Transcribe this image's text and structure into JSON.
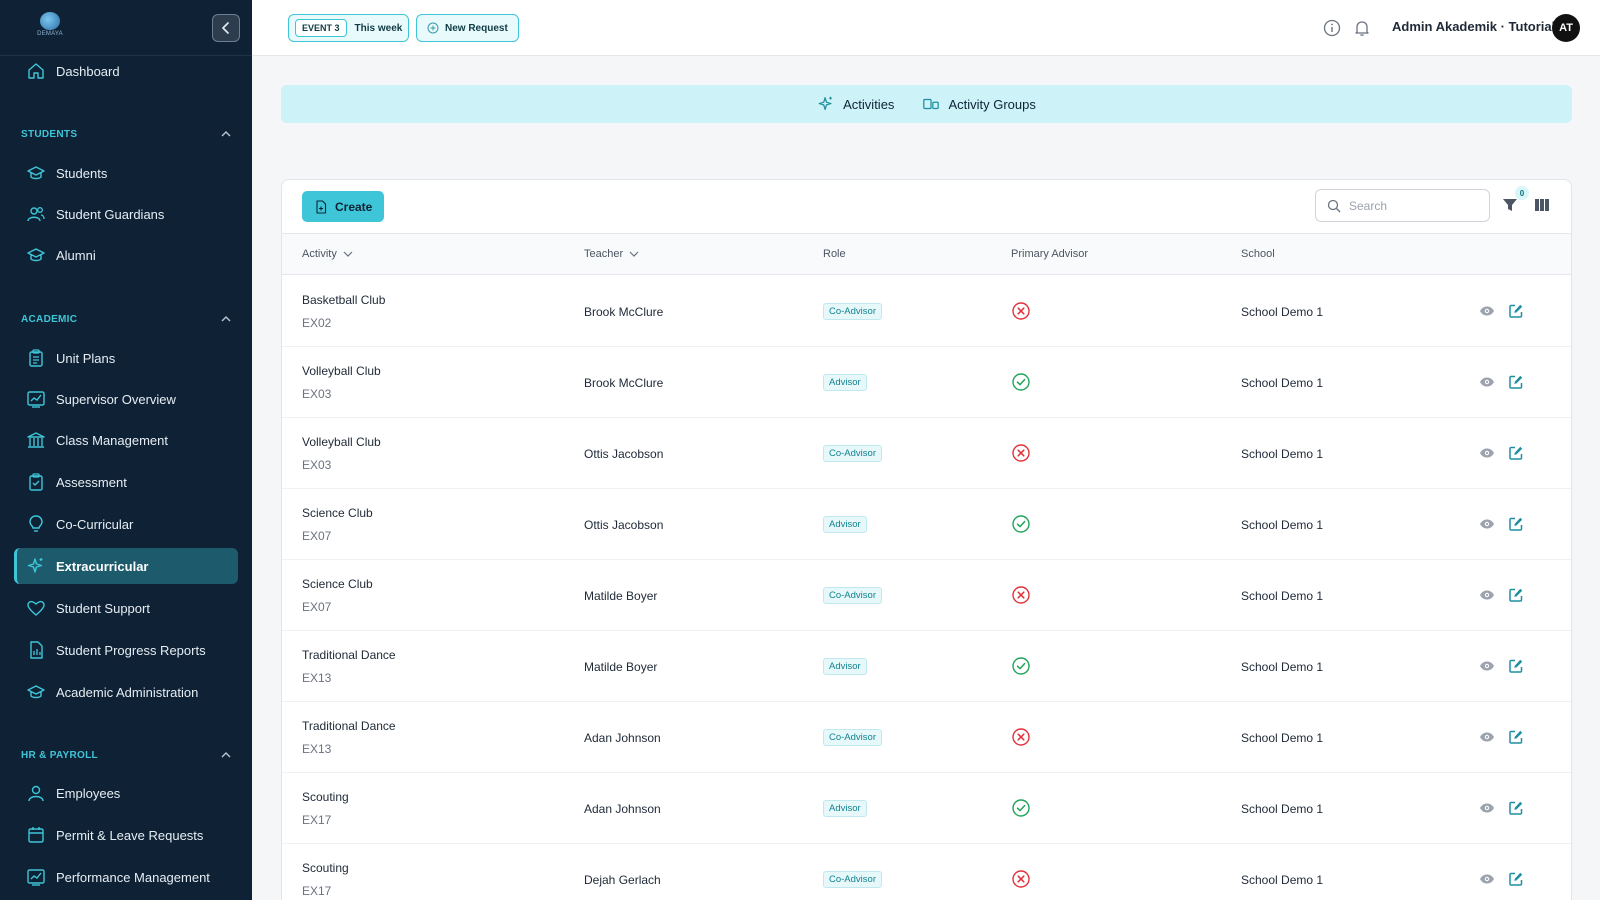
{
  "app": {
    "logo_text": "DEMAYA",
    "collapse_label": "Collapse sidebar"
  },
  "sidebar": {
    "dashboard": "Dashboard",
    "sections": [
      {
        "title": "STUDENTS",
        "items": [
          "Students",
          "Student Guardians",
          "Alumni"
        ]
      },
      {
        "title": "ACADEMIC",
        "items": [
          "Unit Plans",
          "Supervisor Overview",
          "Class Management",
          "Assessment",
          "Co-Curricular",
          "Extracurricular",
          "Student Support",
          "Student Progress Reports",
          "Academic Administration"
        ]
      },
      {
        "title": "HR & PAYROLL",
        "items": [
          "Employees",
          "Permit & Leave Requests",
          "Performance Management"
        ]
      }
    ],
    "active_item": "Extracurricular"
  },
  "topbar": {
    "event_tag": "EVENT 3",
    "event_period": "This week",
    "new_request": "New Request",
    "user_name": "Admin Akademik · Tutorial",
    "avatar_initials": "AT"
  },
  "tabs": [
    {
      "label": "Activities",
      "icon": "sparkle-icon"
    },
    {
      "label": "Activity Groups",
      "icon": "groups-icon"
    }
  ],
  "toolbar": {
    "create_label": "Create",
    "search_placeholder": "Search",
    "filter_count": "0"
  },
  "table": {
    "columns": [
      "Activity",
      "Teacher",
      "Role",
      "Primary Advisor",
      "School"
    ],
    "rows": [
      {
        "activity": "Basketball Club",
        "code": "EX02",
        "teacher": "Brook McClure",
        "role": "Co-Advisor",
        "primary": false,
        "school": "School Demo 1"
      },
      {
        "activity": "Volleyball Club",
        "code": "EX03",
        "teacher": "Brook McClure",
        "role": "Advisor",
        "primary": true,
        "school": "School Demo 1"
      },
      {
        "activity": "Volleyball Club",
        "code": "EX03",
        "teacher": "Ottis Jacobson",
        "role": "Co-Advisor",
        "primary": false,
        "school": "School Demo 1"
      },
      {
        "activity": "Science Club",
        "code": "EX07",
        "teacher": "Ottis Jacobson",
        "role": "Advisor",
        "primary": true,
        "school": "School Demo 1"
      },
      {
        "activity": "Science Club",
        "code": "EX07",
        "teacher": "Matilde Boyer",
        "role": "Co-Advisor",
        "primary": false,
        "school": "School Demo 1"
      },
      {
        "activity": "Traditional Dance",
        "code": "EX13",
        "teacher": "Matilde Boyer",
        "role": "Advisor",
        "primary": true,
        "school": "School Demo 1"
      },
      {
        "activity": "Traditional Dance",
        "code": "EX13",
        "teacher": "Adan Johnson",
        "role": "Co-Advisor",
        "primary": false,
        "school": "School Demo 1"
      },
      {
        "activity": "Scouting",
        "code": "EX17",
        "teacher": "Adan Johnson",
        "role": "Advisor",
        "primary": true,
        "school": "School Demo 1"
      },
      {
        "activity": "Scouting",
        "code": "EX17",
        "teacher": "Dejah Gerlach",
        "role": "Co-Advisor",
        "primary": false,
        "school": "School Demo 1"
      }
    ]
  },
  "colors": {
    "sidebar_bg": "#0f2235",
    "accent": "#3ec6d8",
    "active_bg": "#1d5a6b",
    "success": "#22a35a",
    "danger": "#e0323b"
  }
}
